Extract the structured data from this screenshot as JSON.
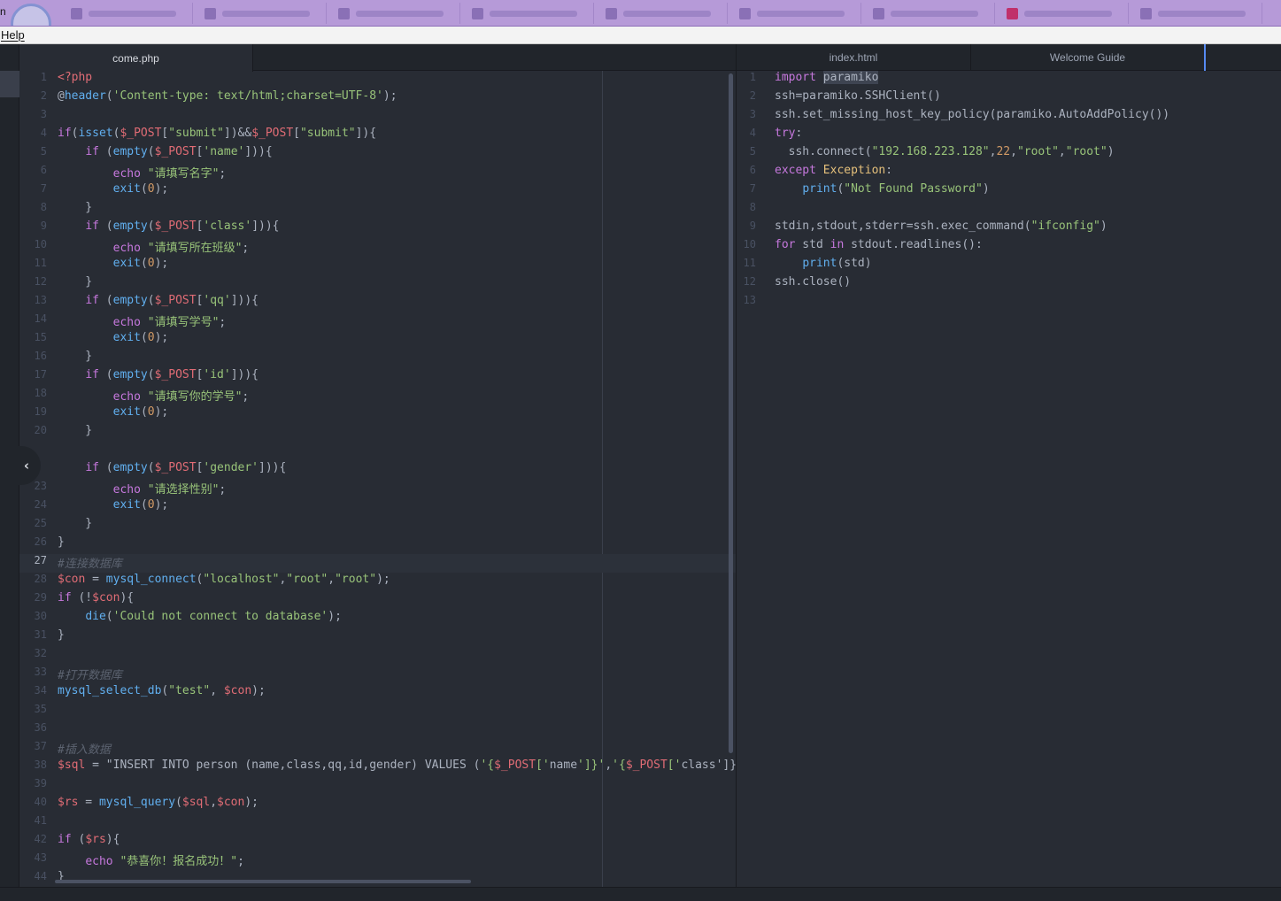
{
  "menubar": {
    "help": "Help"
  },
  "browser_tabs": {
    "count": 9,
    "favicons": [
      "page-icon",
      "page-icon",
      "page-icon",
      "page-icon",
      "page-icon",
      "page-icon",
      "page-icon",
      "red-page-icon",
      "page-icon"
    ]
  },
  "left_pane": {
    "tabs": [
      {
        "label": "come.php",
        "active": true
      }
    ],
    "cursor_line": 27,
    "lines": [
      {
        "n": "1",
        "c": "<?php"
      },
      {
        "n": "2",
        "c": "@header('Content-type: text/html;charset=UTF-8');"
      },
      {
        "n": "3",
        "c": ""
      },
      {
        "n": "4",
        "c": "if(isset($_POST[\"submit\"])&&$_POST[\"submit\"]){"
      },
      {
        "n": "5",
        "c": "    if (empty($_POST['name'])){"
      },
      {
        "n": "6",
        "c": "        echo \"请填写名字\";"
      },
      {
        "n": "7",
        "c": "        exit(0);"
      },
      {
        "n": "8",
        "c": "    }"
      },
      {
        "n": "9",
        "c": "    if (empty($_POST['class'])){"
      },
      {
        "n": "10",
        "c": "        echo \"请填写所在班级\";"
      },
      {
        "n": "11",
        "c": "        exit(0);"
      },
      {
        "n": "12",
        "c": "    }"
      },
      {
        "n": "13",
        "c": "    if (empty($_POST['qq'])){"
      },
      {
        "n": "14",
        "c": "        echo \"请填写学号\";"
      },
      {
        "n": "15",
        "c": "        exit(0);"
      },
      {
        "n": "16",
        "c": "    }"
      },
      {
        "n": "17",
        "c": "    if (empty($_POST['id'])){"
      },
      {
        "n": "18",
        "c": "        echo \"请填写你的学号\";"
      },
      {
        "n": "19",
        "c": "        exit(0);"
      },
      {
        "n": "20",
        "c": "    }"
      },
      {
        "n": "",
        "c": ""
      },
      {
        "n": "",
        "c": "    if (empty($_POST['gender'])){"
      },
      {
        "n": "23",
        "c": "        echo \"请选择性别\";"
      },
      {
        "n": "24",
        "c": "        exit(0);"
      },
      {
        "n": "25",
        "c": "    }"
      },
      {
        "n": "26",
        "c": "}"
      },
      {
        "n": "27",
        "c": "#连接数据库"
      },
      {
        "n": "28",
        "c": "$con = mysql_connect(\"localhost\",\"root\",\"root\");"
      },
      {
        "n": "29",
        "c": "if (!$con){"
      },
      {
        "n": "30",
        "c": "    die('Could not connect to database');"
      },
      {
        "n": "31",
        "c": "}"
      },
      {
        "n": "32",
        "c": ""
      },
      {
        "n": "33",
        "c": "#打开数据库"
      },
      {
        "n": "34",
        "c": "mysql_select_db(\"test\", $con);"
      },
      {
        "n": "35",
        "c": ""
      },
      {
        "n": "36",
        "c": ""
      },
      {
        "n": "37",
        "c": "#插入数据"
      },
      {
        "n": "38",
        "c": "$sql = \"INSERT INTO person (name,class,qq,id,gender) VALUES ('{$_POST['name']}','{$_POST['class']}"
      },
      {
        "n": "39",
        "c": ""
      },
      {
        "n": "40",
        "c": "$rs = mysql_query($sql,$con);"
      },
      {
        "n": "41",
        "c": ""
      },
      {
        "n": "42",
        "c": "if ($rs){"
      },
      {
        "n": "43",
        "c": "    echo \"恭喜你！报名成功！\";"
      },
      {
        "n": "44",
        "c": "}"
      }
    ]
  },
  "right_pane": {
    "tabs": [
      {
        "label": "index.html",
        "active": false
      },
      {
        "label": "Welcome Guide",
        "active": false
      }
    ],
    "lines": [
      {
        "n": "1",
        "c": "import paramiko"
      },
      {
        "n": "2",
        "c": "ssh=paramiko.SSHClient()"
      },
      {
        "n": "3",
        "c": "ssh.set_missing_host_key_policy(paramiko.AutoAddPolicy())"
      },
      {
        "n": "4",
        "c": "try:"
      },
      {
        "n": "5",
        "c": "  ssh.connect(\"192.168.223.128\",22,\"root\",\"root\")"
      },
      {
        "n": "6",
        "c": "except Exception:"
      },
      {
        "n": "7",
        "c": "    print(\"Not Found Password\")"
      },
      {
        "n": "8",
        "c": ""
      },
      {
        "n": "9",
        "c": "stdin,stdout,stderr=ssh.exec_command(\"ifconfig\")"
      },
      {
        "n": "10",
        "c": "for std in stdout.readlines():"
      },
      {
        "n": "11",
        "c": "    print(std)"
      },
      {
        "n": "12",
        "c": "ssh.close()"
      },
      {
        "n": "13",
        "c": ""
      }
    ]
  },
  "colors": {
    "background": "#282c34",
    "keyword": "#c678dd",
    "string": "#98c379",
    "variable": "#e06c75",
    "function": "#61afef",
    "comment": "#5c6370",
    "number": "#d19a66"
  },
  "icons": {
    "collapse": "chevron-left-icon"
  }
}
